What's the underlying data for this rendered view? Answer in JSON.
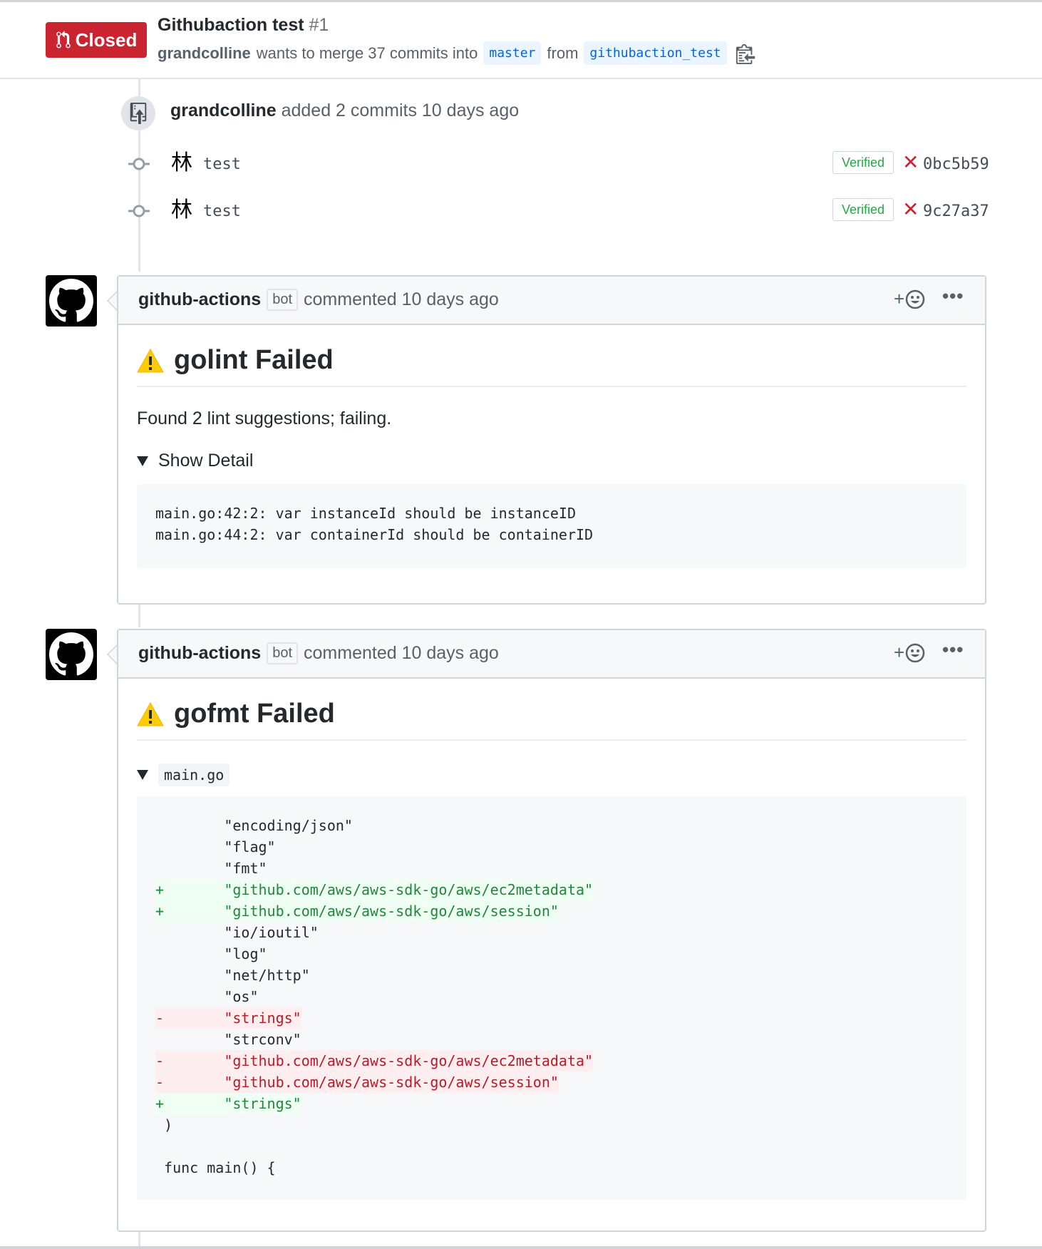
{
  "header": {
    "state": "Closed",
    "title": "Githubaction test",
    "number": "#1",
    "author": "grandcolline",
    "merge_text": "wants to merge 37 commits into",
    "base_branch": "master",
    "from_text": "from",
    "head_branch": "githubaction_test"
  },
  "push_event": {
    "author": "grandcolline",
    "text": "added 2 commits 10 days ago",
    "commits": [
      {
        "avatar": "林",
        "message": "test",
        "verified": "Verified",
        "status": "failure",
        "sha": "0bc5b59"
      },
      {
        "avatar": "林",
        "message": "test",
        "verified": "Verified",
        "status": "failure",
        "sha": "9c27a37"
      }
    ]
  },
  "comments": [
    {
      "author": "github-actions",
      "label": "bot",
      "meta": "commented 10 days ago",
      "reaction": "+",
      "more": "•••",
      "heading": "golint Failed",
      "paragraph": "Found 2 lint suggestions; failing.",
      "details_summary": "Show Detail",
      "code": [
        "main.go:42:2: var instanceId should be instanceID",
        "main.go:44:2: var containerId should be containerID"
      ]
    },
    {
      "author": "github-actions",
      "label": "bot",
      "meta": "commented 10 days ago",
      "reaction": "+",
      "more": "•••",
      "heading": "gofmt Failed",
      "details_summary": "main.go",
      "diff": [
        {
          "type": "ctx",
          "text": "        \"encoding/json\""
        },
        {
          "type": "ctx",
          "text": "        \"flag\""
        },
        {
          "type": "ctx",
          "text": "        \"fmt\""
        },
        {
          "type": "add",
          "text": "+       \"github.com/aws/aws-sdk-go/aws/ec2metadata\""
        },
        {
          "type": "add",
          "text": "+       \"github.com/aws/aws-sdk-go/aws/session\""
        },
        {
          "type": "ctx",
          "text": "        \"io/ioutil\""
        },
        {
          "type": "ctx",
          "text": "        \"log\""
        },
        {
          "type": "ctx",
          "text": "        \"net/http\""
        },
        {
          "type": "ctx",
          "text": "        \"os\""
        },
        {
          "type": "del",
          "text": "-       \"strings\""
        },
        {
          "type": "ctx",
          "text": "        \"strconv\""
        },
        {
          "type": "del",
          "text": "-       \"github.com/aws/aws-sdk-go/aws/ec2metadata\""
        },
        {
          "type": "del",
          "text": "-       \"github.com/aws/aws-sdk-go/aws/session\""
        },
        {
          "type": "add",
          "text": "+       \"strings\""
        },
        {
          "type": "ctx",
          "text": " )"
        },
        {
          "type": "ctx",
          "text": ""
        },
        {
          "type": "ctx",
          "text": " func main() {"
        }
      ]
    }
  ],
  "colors": {
    "closed": "#cb2431",
    "link": "#0366d6",
    "verified": "#28a745",
    "added": "#22863a",
    "removed": "#b31d28"
  },
  "icons": [
    "git-pull-request-icon",
    "clipboard-icon",
    "repo-push-icon",
    "git-commit-icon",
    "x-icon",
    "github-logo-icon",
    "smiley-icon",
    "kebab-horizontal-icon",
    "warning-icon",
    "triangle-down-icon"
  ]
}
